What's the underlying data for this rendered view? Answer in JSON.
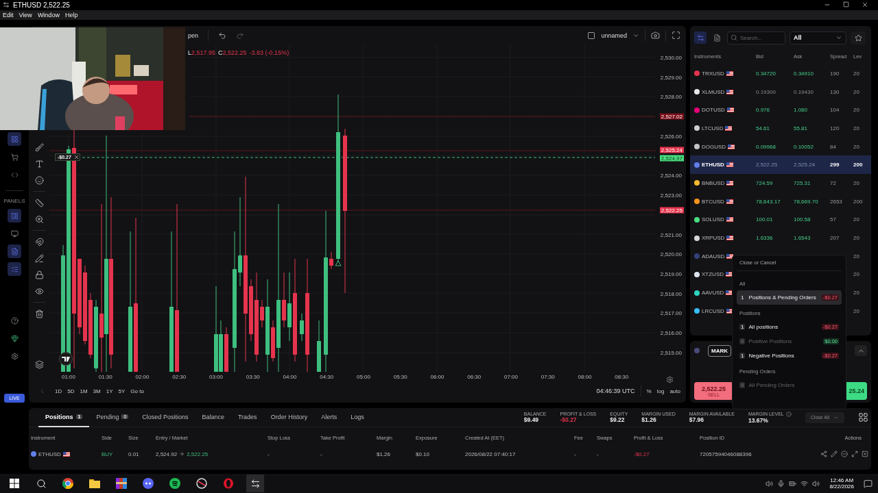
{
  "window": {
    "title": "ETHUSD 2,522.25"
  },
  "menu": [
    "Edit",
    "View",
    "Window",
    "Help"
  ],
  "sidebar": {
    "section_label": "PANELS",
    "panel_buttons": [
      {
        "selected": true
      },
      {
        "selected": false
      },
      {
        "selected": true
      },
      {
        "selected": true
      }
    ],
    "badge": "LIVE"
  },
  "chart_toolbar": {
    "cut_label": "pen",
    "layout_name": "unnamed"
  },
  "legend": {
    "items": [
      {
        "label": "L",
        "value": "2,517.95"
      },
      {
        "label": "C",
        "value": "2,522.25"
      }
    ],
    "change": "-3.83 (-0.15%)"
  },
  "position_line": {
    "pnl": "-$0.27"
  },
  "price_axis": {
    "labels": [
      "2,530.00",
      "2,529.00",
      "2,528.00",
      "2,526.00",
      "2,524.00",
      "2,523.00",
      "2,521.00",
      "2,520.00",
      "2,519.00",
      "2,518.00",
      "2,517.00",
      "2,516.00",
      "2,515.00"
    ],
    "badges": [
      {
        "text": "2,527.02",
        "kind": "high"
      },
      {
        "text": "2,525.24",
        "kind": "ask"
      },
      {
        "text": "2,524.97",
        "kind": "position"
      },
      {
        "text": "2,522.25",
        "kind": "bid"
      }
    ]
  },
  "time_axis": {
    "labels": [
      "01:00",
      "01:30",
      "02:00",
      "02:30",
      "03:00",
      "03:30",
      "04:00",
      "04:30",
      "05:00",
      "05:30",
      "06:00",
      "06:30",
      "07:00",
      "07:30",
      "08:00",
      "08:30"
    ]
  },
  "range_bar": {
    "ranges": [
      "1D",
      "5D",
      "1M",
      "3M",
      "1Y",
      "5Y"
    ],
    "goto": "Go to",
    "clock": "04:46:39 UTC",
    "options": [
      "%",
      "log",
      "auto"
    ]
  },
  "instruments_panel": {
    "search": {
      "placeholder": "Search..."
    },
    "filter": "All",
    "columns": [
      "Instruments",
      "Bid",
      "Ask",
      "Spread",
      "Lev"
    ],
    "rows": [
      {
        "symbol": "TRXUSD",
        "color": "#e5344d",
        "bid": "0.34720",
        "ask": "0.34910",
        "spread": "190",
        "leverage": "20",
        "up": true,
        "selected": false
      },
      {
        "symbol": "XLMUSD",
        "color": "#e8e8e8",
        "bid": "0.19300",
        "ask": "0.19430",
        "spread": "130",
        "leverage": "20",
        "up": false,
        "selected": false
      },
      {
        "symbol": "DOTUSD",
        "color": "#e6007a",
        "bid": "0.976",
        "ask": "1.080",
        "spread": "104",
        "leverage": "20",
        "up": true,
        "selected": false
      },
      {
        "symbol": "LTCUSD",
        "color": "#cfcfcf",
        "bid": "54.61",
        "ask": "55.81",
        "spread": "120",
        "leverage": "20",
        "up": true,
        "selected": false
      },
      {
        "symbol": "DOGUSD",
        "color": "#c4c4c4",
        "bid": "0.09968",
        "ask": "0.10052",
        "spread": "84",
        "leverage": "20",
        "up": true,
        "selected": false
      },
      {
        "symbol": "ETHUSD",
        "color": "#627eea",
        "bid": "2,522.25",
        "ask": "2,525.24",
        "spread": "299",
        "leverage": "200",
        "up": false,
        "selected": true
      },
      {
        "symbol": "BNBUSD",
        "color": "#f3ba2f",
        "bid": "724.59",
        "ask": "725.31",
        "spread": "72",
        "leverage": "20",
        "up": true,
        "selected": false
      },
      {
        "symbol": "BTCUSD",
        "color": "#f7931a",
        "bid": "78,643.17",
        "ask": "78,669.70",
        "spread": "2653",
        "leverage": "200",
        "up": true,
        "selected": false
      },
      {
        "symbol": "SOLUSD",
        "color": "#4ade80",
        "bid": "100.01",
        "ask": "100.58",
        "spread": "57",
        "leverage": "20",
        "up": true,
        "selected": false
      },
      {
        "symbol": "XRPUSD",
        "color": "#d8d8d8",
        "bid": "1.6336",
        "ask": "1.6543",
        "spread": "207",
        "leverage": "20",
        "up": true,
        "selected": false
      },
      {
        "symbol": "ADAUSD",
        "color": "#34407a",
        "leverage": "20",
        "selected": false
      },
      {
        "symbol": "XTZUSD",
        "color": "#dde3ee",
        "leverage": "20",
        "selected": false
      },
      {
        "symbol": "AAVUSD",
        "color": "#2dd4bf",
        "leverage": "20",
        "selected": false
      },
      {
        "symbol": "LRCUSD",
        "color": "#38bdf8",
        "leverage": "20",
        "selected": false
      }
    ]
  },
  "order_panel": {
    "order_type": "MARK",
    "sell": {
      "price": "2,522.25",
      "label": "SELL"
    },
    "buy": {
      "price": "25.24"
    }
  },
  "close_menu": {
    "title": "Close or Cancel",
    "sections": [
      {
        "heading": "All",
        "items": [
          {
            "count": "1",
            "label": "Positions & Pending Orders",
            "amount": "-$0.27",
            "negative": true,
            "disabled": false,
            "selected": true
          }
        ]
      },
      {
        "heading": "Positions",
        "items": [
          {
            "count": "1",
            "label": "All positions",
            "amount": "-$0.27",
            "negative": true,
            "disabled": false,
            "selected": false
          },
          {
            "count": "0",
            "label": "Positive Positions",
            "amount": "$0.00",
            "negative": false,
            "disabled": true,
            "selected": false
          },
          {
            "count": "1",
            "label": "Negative Positions",
            "amount": "-$0.27",
            "negative": true,
            "disabled": false,
            "selected": false
          }
        ]
      },
      {
        "heading": "Pending Orders",
        "items": [
          {
            "count": "0",
            "label": "All Pending Orders",
            "disabled": true,
            "selected": false
          }
        ]
      }
    ]
  },
  "bottom_panel": {
    "tabs": [
      {
        "label": "Positions",
        "count": "1",
        "selected": true
      },
      {
        "label": "Pending",
        "count": "0",
        "selected": false
      },
      {
        "label": "Closed Positions",
        "selected": false
      },
      {
        "label": "Balance",
        "selected": false
      },
      {
        "label": "Trades",
        "selected": false
      },
      {
        "label": "Order History",
        "selected": false
      },
      {
        "label": "Alerts",
        "selected": false
      },
      {
        "label": "Logs",
        "selected": false
      }
    ],
    "stats": [
      {
        "label": "BALANCE",
        "value": "$9.49",
        "negative": false
      },
      {
        "label": "PROFIT & LOSS",
        "value": "-$0.27",
        "negative": true
      },
      {
        "label": "EQUITY",
        "value": "$9.22",
        "negative": false
      },
      {
        "label": "MARGIN USED",
        "value": "$1.26",
        "negative": false
      },
      {
        "label": "MARGIN AVAILABLE",
        "value": "$7.96",
        "negative": false
      },
      {
        "label": "MARGIN LEVEL",
        "value": "13.67%",
        "negative": false,
        "info": true
      }
    ],
    "close_all": "Close All",
    "table": {
      "columns": [
        "Instrument",
        "Side",
        "Size",
        "Entry / Market",
        "Stop Loss",
        "Take Profit",
        "Margin",
        "Exposure",
        "Created At (EET)",
        "Fee",
        "Swaps",
        "Profit & Loss",
        "Position ID",
        "Actions"
      ],
      "rows": [
        {
          "instrument": "ETHUSD",
          "side": "BUY",
          "size": "0.01",
          "entry": "2,524.92",
          "market": "2,522.25",
          "stop_loss": "-",
          "take_profit": "-",
          "margin": "$1.26",
          "exposure": "$0.10",
          "created_at": "2026/08/22 07:40:17",
          "fee": "-",
          "swaps": "-",
          "pnl": "-$0.27",
          "position_id": "72057594046088396"
        }
      ]
    }
  },
  "taskbar": {
    "time": "12:46 AM",
    "date": "8/22/2026"
  }
}
